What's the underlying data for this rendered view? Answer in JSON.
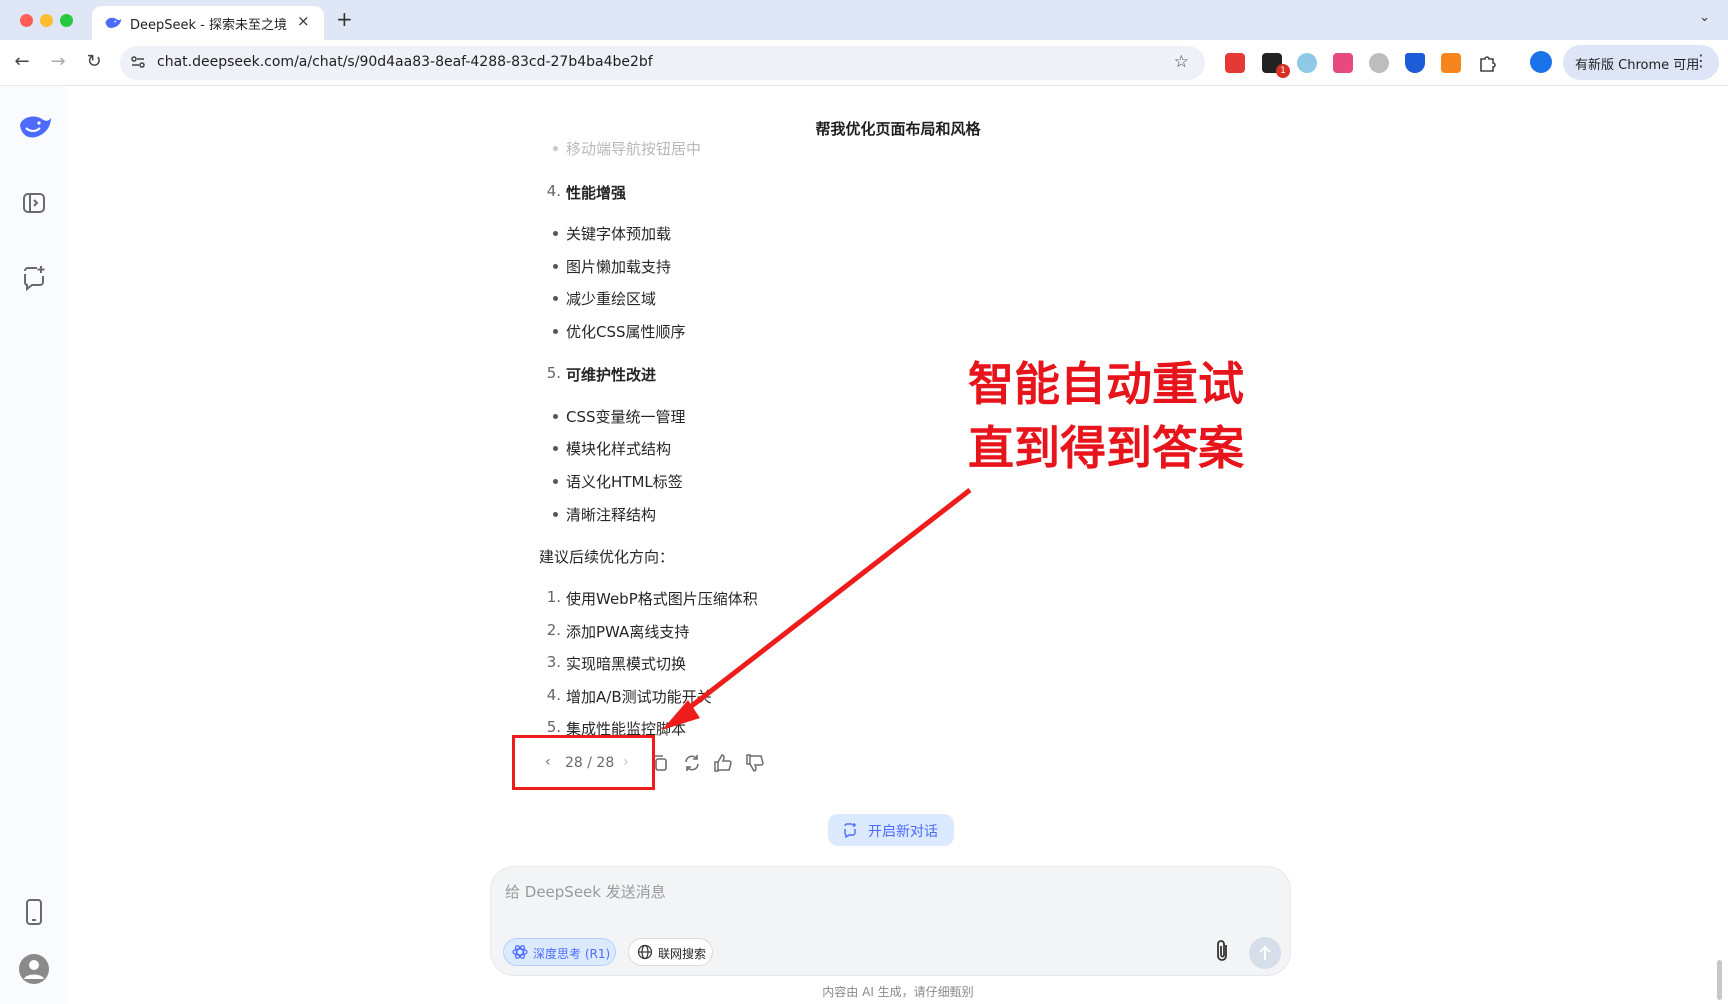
{
  "browser": {
    "tab_title": "DeepSeek - 探索未至之境",
    "tab_close": "×",
    "new_tab": "+",
    "url": "chat.deepseek.com/a/chat/s/90d4aa83-8eaf-4288-83cd-27b4ba4be2bf",
    "update_label": "有新版 Chrome 可用",
    "extension_badge": "1",
    "back_glyph": "←",
    "forward_glyph": "→",
    "reload_glyph": "↻",
    "star_glyph": "☆",
    "more_glyph": "⋮",
    "tab_menu_glyph": "⌄"
  },
  "chat": {
    "title": "帮我优化页面布局和风格",
    "faded_item": "移动端导航按钮居中",
    "sections": [
      {
        "num": "4.",
        "heading": "性能增强",
        "bullets": [
          "关键字体预加载",
          "图片懒加载支持",
          "减少重绘区域",
          "优化CSS属性顺序"
        ]
      },
      {
        "num": "5.",
        "heading": "可维护性改进",
        "bullets": [
          "CSS变量统一管理",
          "模块化样式结构",
          "语义化HTML标签",
          "清晰注释结构"
        ]
      }
    ],
    "followup_intro": "建议后续优化方向：",
    "followups": [
      {
        "num": "1.",
        "text": "使用WebP格式图片压缩体积"
      },
      {
        "num": "2.",
        "text": "添加PWA离线支持"
      },
      {
        "num": "3.",
        "text": "实现暗黑模式切换"
      },
      {
        "num": "4.",
        "text": "增加A/B测试功能开关"
      },
      {
        "num": "5.",
        "text": "集成性能监控脚本"
      }
    ],
    "pager": {
      "text": "28 / 28",
      "prev": "‹",
      "next": "›",
      "current": 28,
      "total": 28
    },
    "new_chat_label": "开启新对话"
  },
  "annotation": {
    "line1": "智能自动重试",
    "line2": "直到得到答案",
    "color": "#e8141b"
  },
  "composer": {
    "placeholder": "给 DeepSeek 发送消息",
    "deep_think_label": "深度思考 (R1)",
    "web_search_label": "联网搜索"
  },
  "footer": {
    "disclaimer": "内容由 AI 生成，请仔细甄别"
  },
  "colors": {
    "brand": "#4d6bfe",
    "annotation_red": "#e8141b"
  },
  "icons": {
    "sidebar": [
      "deepseek-logo-icon",
      "sidebar-toggle-icon",
      "new-chat-icon",
      "phone-icon",
      "user-avatar-icon"
    ],
    "actions": [
      "copy-icon",
      "regenerate-icon",
      "thumbs-up-icon",
      "thumbs-down-icon"
    ]
  }
}
